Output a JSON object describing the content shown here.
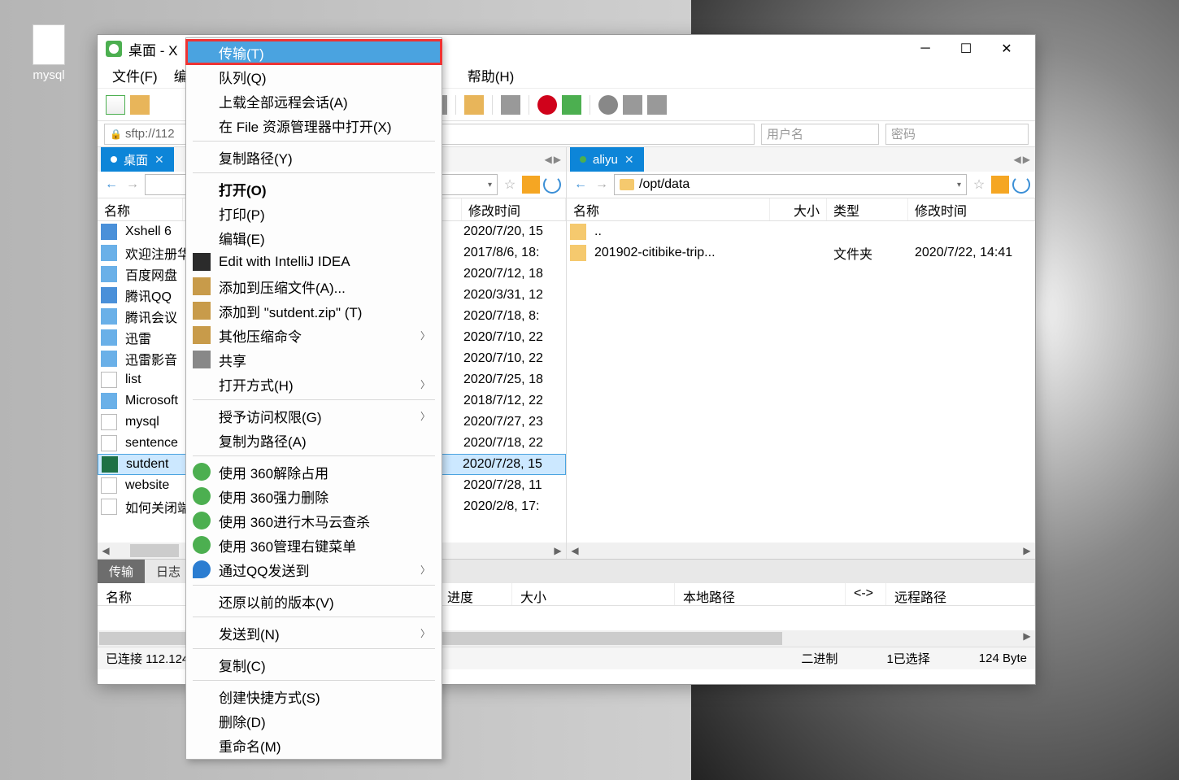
{
  "desktop_icon": {
    "label": "mysql"
  },
  "window": {
    "title": "桌面 - X",
    "menubar": [
      "文件(F)",
      "编",
      "",
      "",
      "",
      "帮助(H)"
    ],
    "address": {
      "protocol_text": "sftp://112",
      "user_ph": "用户名",
      "pass_ph": "密码"
    }
  },
  "left_pane": {
    "tab": "桌面",
    "path": "",
    "cols": {
      "name": "名称",
      "mod": "修改时间"
    },
    "files": [
      {
        "name": "Xshell 6",
        "icon": "fi-exe",
        "mod": "2020/7/20, 15"
      },
      {
        "name": "欢迎注册华",
        "icon": "fi-lnk",
        "mod": "2017/8/6, 18:"
      },
      {
        "name": "百度网盘",
        "icon": "fi-lnk",
        "mod": "2020/7/12, 18"
      },
      {
        "name": "腾讯QQ",
        "icon": "fi-exe",
        "mod": "2020/3/31, 12"
      },
      {
        "name": "腾讯会议",
        "icon": "fi-lnk",
        "mod": "2020/7/18, 8:"
      },
      {
        "name": "迅雷",
        "icon": "fi-lnk",
        "mod": "2020/7/10, 22"
      },
      {
        "name": "迅雷影音",
        "icon": "fi-lnk",
        "mod": "2020/7/10, 22"
      },
      {
        "name": "list",
        "icon": "fi-txt",
        "mod": "2020/7/25, 18"
      },
      {
        "name": "Microsoft",
        "icon": "fi-lnk",
        "mod": "2018/7/12, 22"
      },
      {
        "name": "mysql",
        "icon": "fi-txt",
        "mod": "2020/7/27, 23"
      },
      {
        "name": "sentence",
        "icon": "fi-txt",
        "mod": "2020/7/18, 22"
      },
      {
        "name": "sutdent",
        "icon": "fi-xls",
        "mod": "2020/7/28, 15",
        "selected": true
      },
      {
        "name": "website",
        "icon": "fi-txt",
        "mod": "2020/7/28, 11"
      },
      {
        "name": "如何关闭端",
        "icon": "fi-txt",
        "mod": "2020/2/8, 17:"
      }
    ]
  },
  "right_pane": {
    "tab": "aliyu",
    "path": "/opt/data",
    "cols": {
      "name": "名称",
      "size": "大小",
      "type": "类型",
      "mod": "修改时间"
    },
    "files": [
      {
        "name": "..",
        "icon": "fi-fold",
        "size": "",
        "type": "",
        "mod": ""
      },
      {
        "name": "201902-citibike-trip...",
        "icon": "fi-fold",
        "size": "",
        "type": "文件夹",
        "mod": "2020/7/22, 14:41"
      }
    ]
  },
  "bottom": {
    "tabs": [
      "传输",
      "日志"
    ],
    "cols": [
      "名称",
      "进度",
      "大小",
      "本地路径",
      "<->",
      "远程路径"
    ]
  },
  "status": {
    "conn": "已连接 112.124",
    "mode": "二进制",
    "sel": "1已选择",
    "bytes": "124 Byte"
  },
  "ctx": {
    "items": [
      {
        "label": "传输(T)",
        "hl": true
      },
      {
        "label": "队列(Q)"
      },
      {
        "label": "上载全部远程会话(A)"
      },
      {
        "label": "在 File 资源管理器中打开(X)"
      },
      {
        "sep": true
      },
      {
        "label": "复制路径(Y)"
      },
      {
        "sep": true
      },
      {
        "label": "打开(O)",
        "bold": true
      },
      {
        "label": "打印(P)"
      },
      {
        "label": "编辑(E)"
      },
      {
        "label": "Edit with IntelliJ IDEA",
        "icon": "cico-ij"
      },
      {
        "label": "添加到压缩文件(A)...",
        "icon": "cico-zip"
      },
      {
        "label": "添加到 \"sutdent.zip\" (T)",
        "icon": "cico-zip"
      },
      {
        "label": "其他压缩命令",
        "icon": "cico-zip",
        "sub": true
      },
      {
        "label": "共享",
        "icon": "cico-share"
      },
      {
        "label": "打开方式(H)",
        "sub": true
      },
      {
        "sep": true
      },
      {
        "label": "授予访问权限(G)",
        "sub": true
      },
      {
        "label": "复制为路径(A)"
      },
      {
        "sep": true
      },
      {
        "label": "使用 360解除占用",
        "icon": "cico-360"
      },
      {
        "label": "使用 360强力删除",
        "icon": "cico-360"
      },
      {
        "label": "使用 360进行木马云查杀",
        "icon": "cico-360"
      },
      {
        "label": "使用 360管理右键菜单",
        "icon": "cico-360"
      },
      {
        "label": "通过QQ发送到",
        "icon": "cico-qq",
        "sub": true
      },
      {
        "sep": true
      },
      {
        "label": "还原以前的版本(V)"
      },
      {
        "sep": true
      },
      {
        "label": "发送到(N)",
        "sub": true
      },
      {
        "sep": true
      },
      {
        "label": "复制(C)"
      },
      {
        "sep": true
      },
      {
        "label": "创建快捷方式(S)"
      },
      {
        "label": "删除(D)"
      },
      {
        "label": "重命名(M)"
      }
    ]
  }
}
